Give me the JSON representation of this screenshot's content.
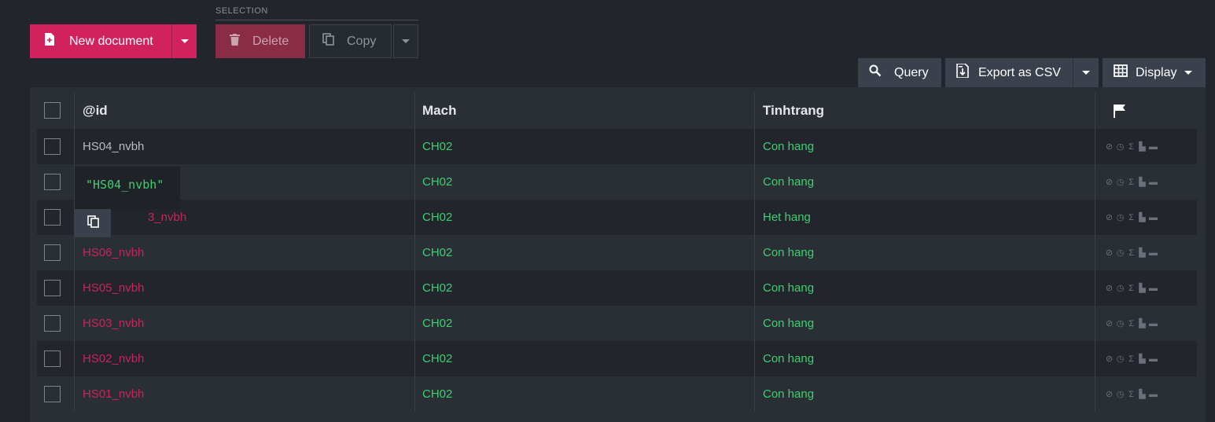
{
  "toolbar": {
    "new_document_label": "New document",
    "selection_label": "SELECTION",
    "delete_label": "Delete",
    "copy_label": "Copy",
    "query_label": "Query",
    "export_label": "Export as CSV",
    "display_label": "Display"
  },
  "table": {
    "columns": [
      "@id",
      "Mach",
      "Tinhtrang"
    ],
    "rows": [
      {
        "id": "HS04_nvbh",
        "mach": "CH02",
        "tinhtrang": "Con hang"
      },
      {
        "id": "",
        "mach": "CH02",
        "tinhtrang": "Con hang"
      },
      {
        "id": "3_nvbh",
        "mach": "CH02",
        "tinhtrang": "Het hang"
      },
      {
        "id": "HS06_nvbh",
        "mach": "CH02",
        "tinhtrang": "Con hang"
      },
      {
        "id": "HS05_nvbh",
        "mach": "CH02",
        "tinhtrang": "Con hang"
      },
      {
        "id": "HS03_nvbh",
        "mach": "CH02",
        "tinhtrang": "Con hang"
      },
      {
        "id": "HS02_nvbh",
        "mach": "CH02",
        "tinhtrang": "Con hang"
      },
      {
        "id": "HS01_nvbh",
        "mach": "CH02",
        "tinhtrang": "Con hang"
      }
    ]
  },
  "tooltip": {
    "text": "\"HS04_nvbh\""
  },
  "colors": {
    "accent": "#d1225e",
    "green": "#3ecf72",
    "pink": "#c8255a"
  },
  "icons": [
    "new-document-icon",
    "trash-icon",
    "copy-icon",
    "search-icon",
    "export-icon",
    "grid-icon",
    "flag-icon",
    "attachment-icon",
    "history-icon",
    "sigma-icon",
    "file-icon",
    "archive-icon"
  ]
}
